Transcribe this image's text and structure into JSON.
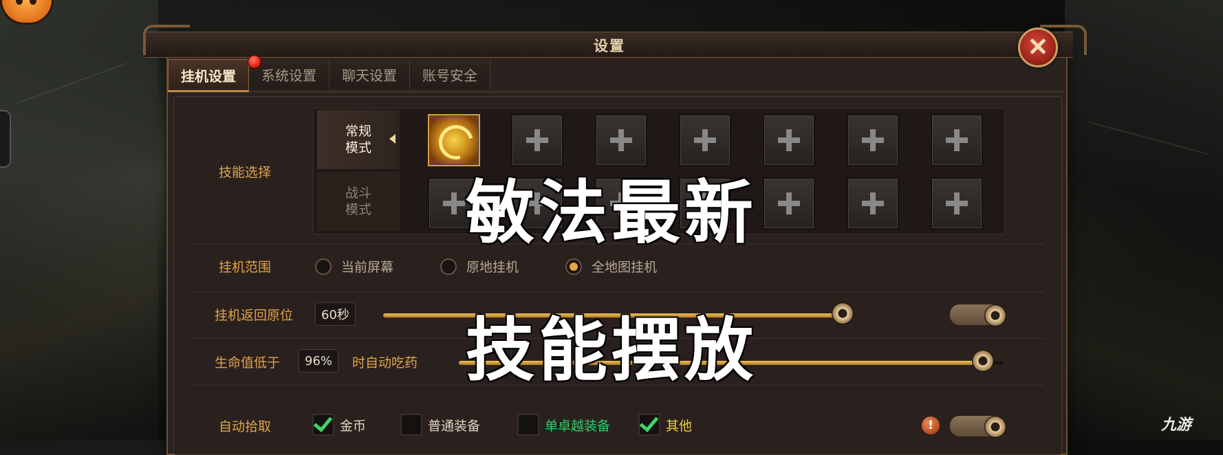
{
  "dialog": {
    "title": "设置",
    "tabs": [
      "挂机设置",
      "系统设置",
      "聊天设置",
      "账号安全"
    ]
  },
  "skill_select": {
    "label": "技能选择",
    "modes": [
      {
        "line1": "常规",
        "line2": "模式"
      },
      {
        "line1": "战斗",
        "line2": "模式"
      }
    ]
  },
  "range": {
    "label": "挂机范围",
    "options": [
      "当前屏幕",
      "原地挂机",
      "全地图挂机"
    ],
    "selected_index": 2
  },
  "return": {
    "label": "挂机返回原位",
    "value": "60秒",
    "slider_fraction": 0.98,
    "toggle_on": true
  },
  "hp": {
    "label": "生命值低于",
    "value": "96%",
    "suffix": "时自动吃药",
    "slider_fraction": 0.96
  },
  "pickup": {
    "label": "自动拾取",
    "items": [
      {
        "label": "金币",
        "checked": true,
        "color": "#e0d4c2"
      },
      {
        "label": "普通装备",
        "checked": false,
        "color": "#e0d4c2"
      },
      {
        "label": "单卓越装备",
        "checked": false,
        "color": "#36c96a"
      },
      {
        "label": "其他",
        "checked": true,
        "color": "#f0d040"
      }
    ],
    "warn_icon": "!",
    "toggle_on": true
  },
  "overlay": {
    "line1": "敏法最新",
    "line2": "技能摆放"
  },
  "watermark": "九游",
  "icons": [
    "close-icon",
    "plus-icon",
    "dragon-skill-icon",
    "checkmark-icon",
    "warning-icon"
  ]
}
